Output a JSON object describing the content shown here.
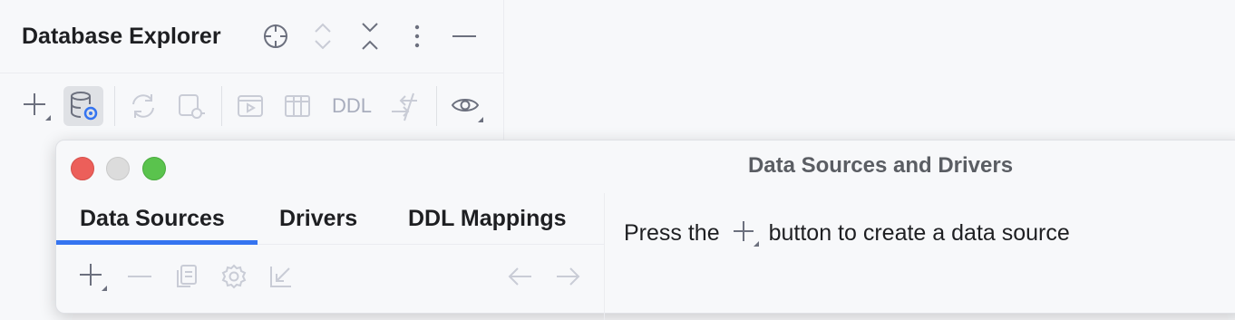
{
  "panel": {
    "title": "Database Explorer",
    "header_icons": [
      "locate-icon",
      "expand-all-icon",
      "collapse-all-icon",
      "more-vertical-icon",
      "hide-icon"
    ],
    "toolbar": {
      "icons": [
        "add-icon",
        "data-source-properties-icon",
        "refresh-icon",
        "disconnect-icon",
        "console-icon",
        "table-icon",
        "compare-icon",
        "view-options-icon"
      ],
      "ddl_label": "DDL"
    }
  },
  "dialog": {
    "title": "Data Sources and Drivers",
    "tabs": [
      {
        "label": "Data Sources",
        "selected": true
      },
      {
        "label": "Drivers",
        "selected": false
      },
      {
        "label": "DDL Mappings",
        "selected": false
      }
    ],
    "subtoolbar_icons": [
      "add-icon",
      "remove-icon",
      "duplicate-icon",
      "settings-icon",
      "import-icon",
      "back-icon",
      "forward-icon"
    ],
    "message": {
      "before": "Press the",
      "after": "button to create a data source"
    }
  },
  "colors": {
    "accent": "#3574f0",
    "close": "#ec5f5a",
    "minimize": "#dcdcdc",
    "zoom": "#5ac34d"
  }
}
